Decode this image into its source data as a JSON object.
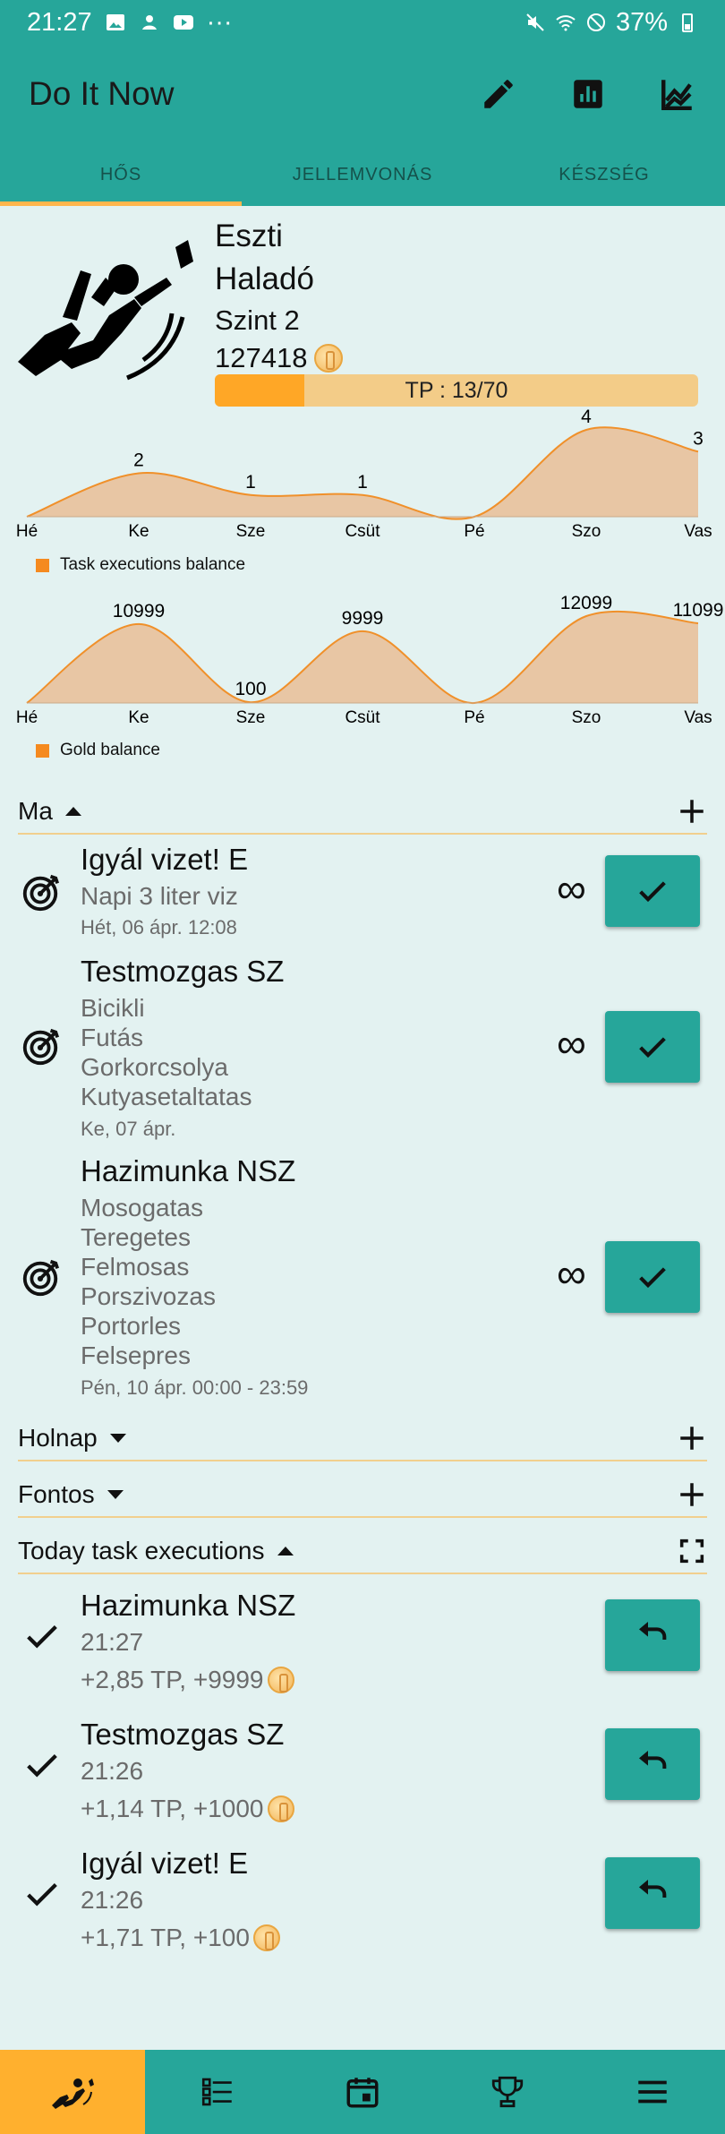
{
  "status_bar": {
    "time": "21:27",
    "more": "···",
    "battery": "37%"
  },
  "app": {
    "title": "Do It Now"
  },
  "tabs": [
    {
      "label": "HŐS",
      "active": true
    },
    {
      "label": "JELLEMVONÁS",
      "active": false
    },
    {
      "label": "KÉSZSÉG",
      "active": false
    }
  ],
  "hero": {
    "name": "Eszti",
    "level_name": "Haladó",
    "level": "Szint 2",
    "gold": "127418",
    "tp_text": "TP : 13/70",
    "tp_current": 13,
    "tp_max": 70
  },
  "chart_data": [
    {
      "type": "area",
      "categories": [
        "Hé",
        "Ke",
        "Sze",
        "Csüt",
        "Pé",
        "Szo",
        "Vas"
      ],
      "series": [
        {
          "name": "Task executions balance",
          "values": [
            0,
            2,
            1,
            1,
            0,
            4,
            3
          ]
        }
      ],
      "data_labels": [
        "",
        "2",
        "1",
        "1",
        "",
        "4",
        "3"
      ],
      "color": "#f0902a",
      "fill": "#e8c6a4"
    },
    {
      "type": "area",
      "categories": [
        "Hé",
        "Ke",
        "Sze",
        "Csüt",
        "Pé",
        "Szo",
        "Vas"
      ],
      "series": [
        {
          "name": "Gold balance",
          "values": [
            0,
            10999,
            100,
            9999,
            0,
            12099,
            11099
          ]
        }
      ],
      "data_labels": [
        "",
        "10999",
        "100",
        "9999",
        "",
        "12099",
        "11099"
      ],
      "color": "#f0902a",
      "fill": "#e8c6a4"
    }
  ],
  "sections": {
    "today": {
      "label": "Ma",
      "expanded": true
    },
    "tomorrow": {
      "label": "Holnap",
      "expanded": false
    },
    "important": {
      "label": "Fontos",
      "expanded": false
    },
    "executions": {
      "label": "Today task executions",
      "expanded": true
    }
  },
  "tasks": [
    {
      "title": "Igyál vizet! E",
      "lines": [
        "Napi 3 liter viz"
      ],
      "date": "Hét, 06 ápr. 12:08",
      "repeat": "∞"
    },
    {
      "title": "Testmozgas SZ",
      "lines": [
        "Bicikli",
        "Futás",
        "Gorkorcsolya",
        "Kutyasetaltatas"
      ],
      "date": "Ke, 07 ápr.",
      "repeat": "∞"
    },
    {
      "title": "Hazimunka NSZ",
      "lines": [
        "Mosogatas",
        "Teregetes",
        "Felmosas",
        "Porszivozas",
        "Portorles",
        "Felsepres"
      ],
      "date": "Pén, 10 ápr. 00:00 - 23:59",
      "repeat": "∞"
    }
  ],
  "executions": [
    {
      "title": "Hazimunka NSZ",
      "time": "21:27",
      "reward": "+2,85 TP, +9999"
    },
    {
      "title": "Testmozgas SZ",
      "time": "21:26",
      "reward": "+1,14 TP, +1000"
    },
    {
      "title": "Igyál vizet! E",
      "time": "21:26",
      "reward": "+1,71 TP, +100"
    }
  ],
  "colors": {
    "primary": "#26a69a",
    "accent": "#ffb64c",
    "background": "#e3f2f1"
  },
  "bottom_nav": [
    {
      "icon": "hero-icon",
      "active": true
    },
    {
      "icon": "task-list-icon",
      "active": false
    },
    {
      "icon": "calendar-icon",
      "active": false
    },
    {
      "icon": "trophy-icon",
      "active": false
    },
    {
      "icon": "menu-icon",
      "active": false
    }
  ]
}
